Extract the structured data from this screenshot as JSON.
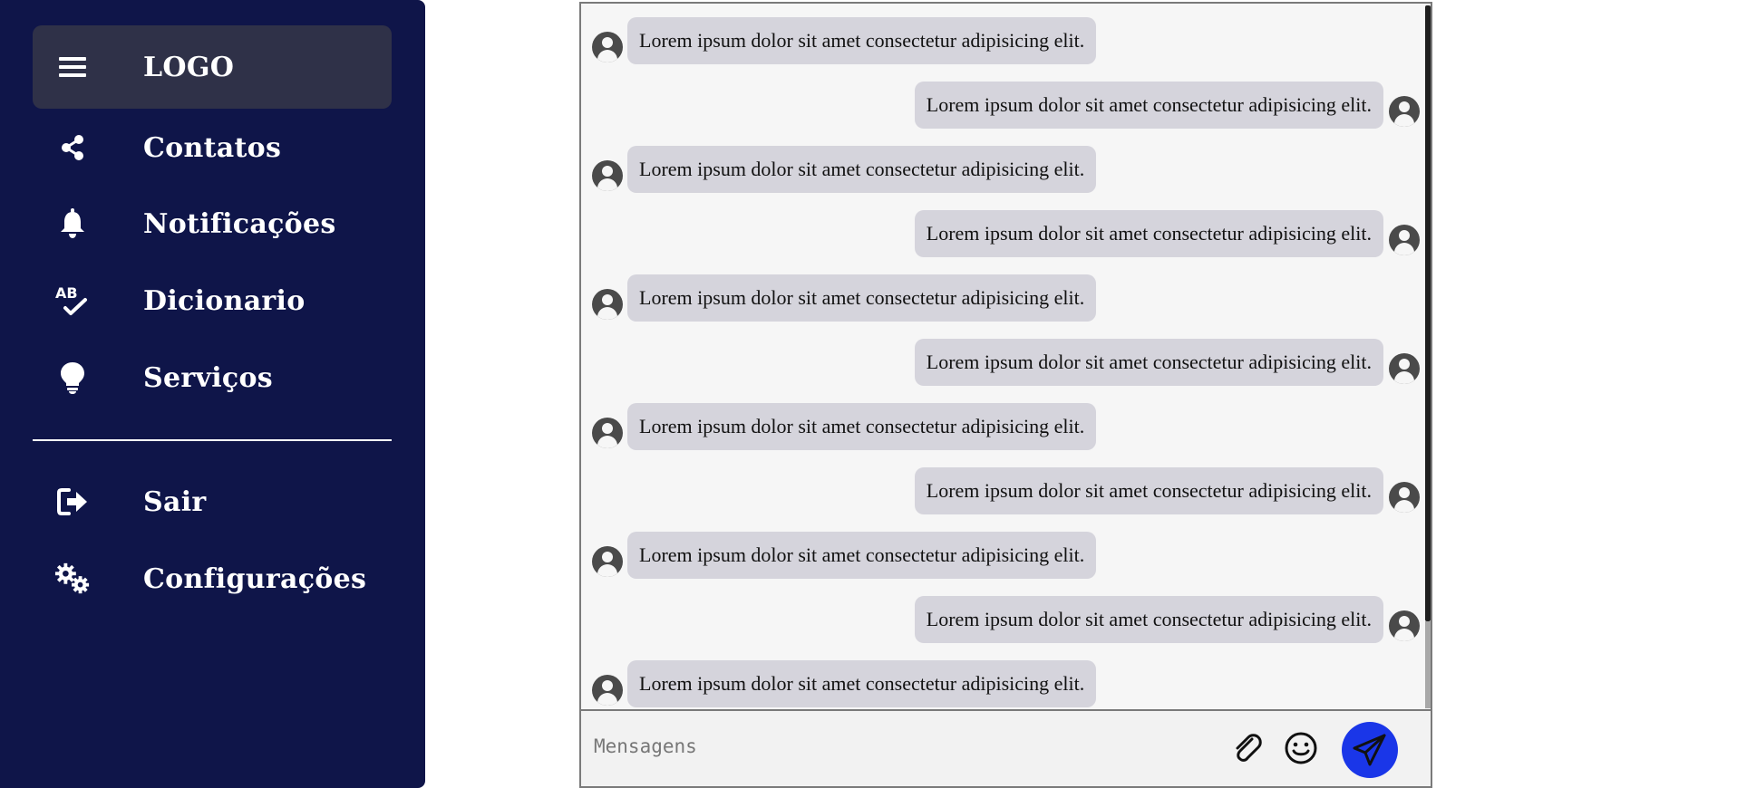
{
  "sidebar": {
    "background": "#0f1549",
    "logo": {
      "icon": "menu-icon",
      "label": "LOGO"
    },
    "items": [
      {
        "icon": "share-icon",
        "label": "Contatos"
      },
      {
        "icon": "bell-icon",
        "label": "Notificações"
      },
      {
        "icon": "spellcheck-icon",
        "label": "Dicionario"
      },
      {
        "icon": "lightbulb-icon",
        "label": "Serviços"
      }
    ],
    "bottom_items": [
      {
        "icon": "logout-icon",
        "label": "Sair"
      },
      {
        "icon": "gears-icon",
        "label": "Configurações"
      }
    ]
  },
  "chat": {
    "messages": [
      {
        "side": "left",
        "text": "Lorem ipsum dolor sit amet consectetur adipisicing elit."
      },
      {
        "side": "right",
        "text": "Lorem ipsum dolor sit amet consectetur adipisicing elit."
      },
      {
        "side": "left",
        "text": "Lorem ipsum dolor sit amet consectetur adipisicing elit."
      },
      {
        "side": "right",
        "text": "Lorem ipsum dolor sit amet consectetur adipisicing elit."
      },
      {
        "side": "left",
        "text": "Lorem ipsum dolor sit amet consectetur adipisicing elit."
      },
      {
        "side": "right",
        "text": "Lorem ipsum dolor sit amet consectetur adipisicing elit."
      },
      {
        "side": "left",
        "text": "Lorem ipsum dolor sit amet consectetur adipisicing elit."
      },
      {
        "side": "right",
        "text": "Lorem ipsum dolor sit amet consectetur adipisicing elit."
      },
      {
        "side": "left",
        "text": "Lorem ipsum dolor sit amet consectetur adipisicing elit."
      },
      {
        "side": "right",
        "text": "Lorem ipsum dolor sit amet consectetur adipisicing elit."
      },
      {
        "side": "left",
        "text": "Lorem ipsum dolor sit amet consectetur adipisicing elit."
      }
    ],
    "composer": {
      "placeholder": "Mensagens",
      "attach_icon": "paperclip-icon",
      "emoji_icon": "smiley-icon",
      "send_icon": "send-icon",
      "send_color": "#1a36e8"
    }
  }
}
